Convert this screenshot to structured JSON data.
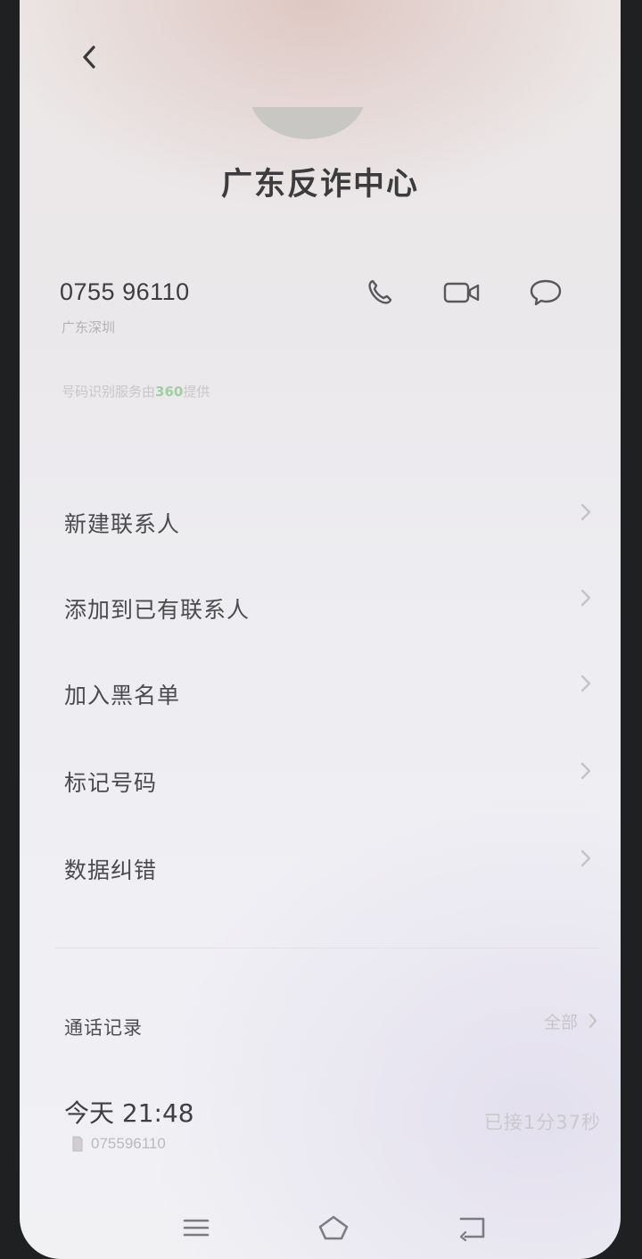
{
  "header": {
    "title": "广东反诈中心"
  },
  "contact": {
    "number": "0755 96110",
    "location": "广东深圳",
    "provider_prefix": "号码识别服务由",
    "provider_brand": "360",
    "provider_suffix": "提供"
  },
  "actions": [
    {
      "name": "call",
      "icon": "phone-icon"
    },
    {
      "name": "video-call",
      "icon": "video-camera-icon"
    },
    {
      "name": "message",
      "icon": "chat-bubble-icon"
    }
  ],
  "menu": {
    "items": [
      {
        "label": "新建联系人"
      },
      {
        "label": "添加到已有联系人"
      },
      {
        "label": "加入黑名单"
      },
      {
        "label": "标记号码"
      },
      {
        "label": "数据纠错"
      }
    ]
  },
  "call_log": {
    "header": "通话记录",
    "all_label": "全部",
    "entries": [
      {
        "time": "今天 21:48",
        "number": "075596110",
        "status": "已接1分37秒"
      }
    ]
  },
  "colors": {
    "text_primary": "#3c3b3d",
    "text_secondary": "#b3b1b4",
    "brand_360": "#9fcf9f"
  }
}
